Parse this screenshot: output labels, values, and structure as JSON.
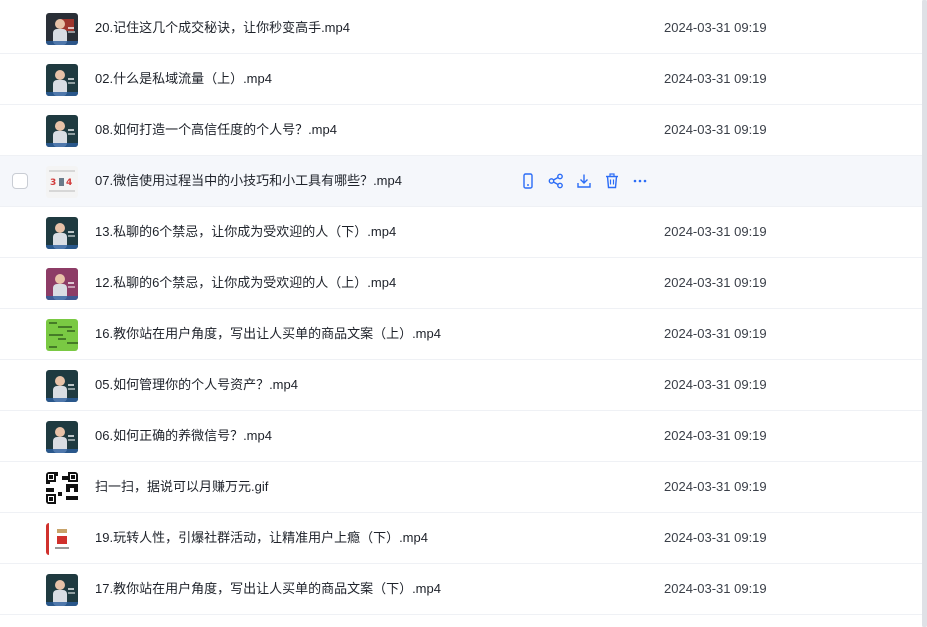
{
  "files": [
    {
      "name": "20.记住这几个成交秘诀，让你秒变高手.mp4",
      "date": "2024-03-31 09:19",
      "thumb": "video-dark-red"
    },
    {
      "name": "02.什么是私域流量（上）.mp4",
      "date": "2024-03-31 09:19",
      "thumb": "video-teal"
    },
    {
      "name": "08.如何打造一个高信任度的个人号？.mp4",
      "date": "2024-03-31 09:19",
      "thumb": "video-teal"
    },
    {
      "name": "07.微信使用过程当中的小技巧和小工具有哪些？.mp4",
      "date": "",
      "thumb": "slide-numbers",
      "hovered": true
    },
    {
      "name": "13.私聊的6个禁忌，让你成为受欢迎的人（下）.mp4",
      "date": "2024-03-31 09:19",
      "thumb": "video-teal"
    },
    {
      "name": "12.私聊的6个禁忌，让你成为受欢迎的人（上）.mp4",
      "date": "2024-03-31 09:19",
      "thumb": "video-pink"
    },
    {
      "name": "16.教你站在用户角度，写出让人买单的商品文案（上）.mp4",
      "date": "2024-03-31 09:19",
      "thumb": "green-chat"
    },
    {
      "name": "05.如何管理你的个人号资产？.mp4",
      "date": "2024-03-31 09:19",
      "thumb": "video-teal"
    },
    {
      "name": "06.如何正确的养微信号？.mp4",
      "date": "2024-03-31 09:19",
      "thumb": "video-teal"
    },
    {
      "name": "扫一扫，据说可以月赚万元.gif",
      "date": "2024-03-31 09:19",
      "thumb": "qr-code"
    },
    {
      "name": "19.玩转人性，引爆社群活动，让精准用户上瘾（下）.mp4",
      "date": "2024-03-31 09:19",
      "thumb": "poster-red"
    },
    {
      "name": "17.教你站在用户角度，写出让人买单的商品文案（下）.mp4",
      "date": "2024-03-31 09:19",
      "thumb": "video-teal"
    }
  ],
  "hover_actions": [
    "phone-icon",
    "share-icon",
    "download-icon",
    "delete-icon",
    "more-icon"
  ],
  "colors": {
    "accent": "#2b6cf6",
    "hover_bg": "#f5f7fb",
    "divider": "#eff1f5"
  }
}
